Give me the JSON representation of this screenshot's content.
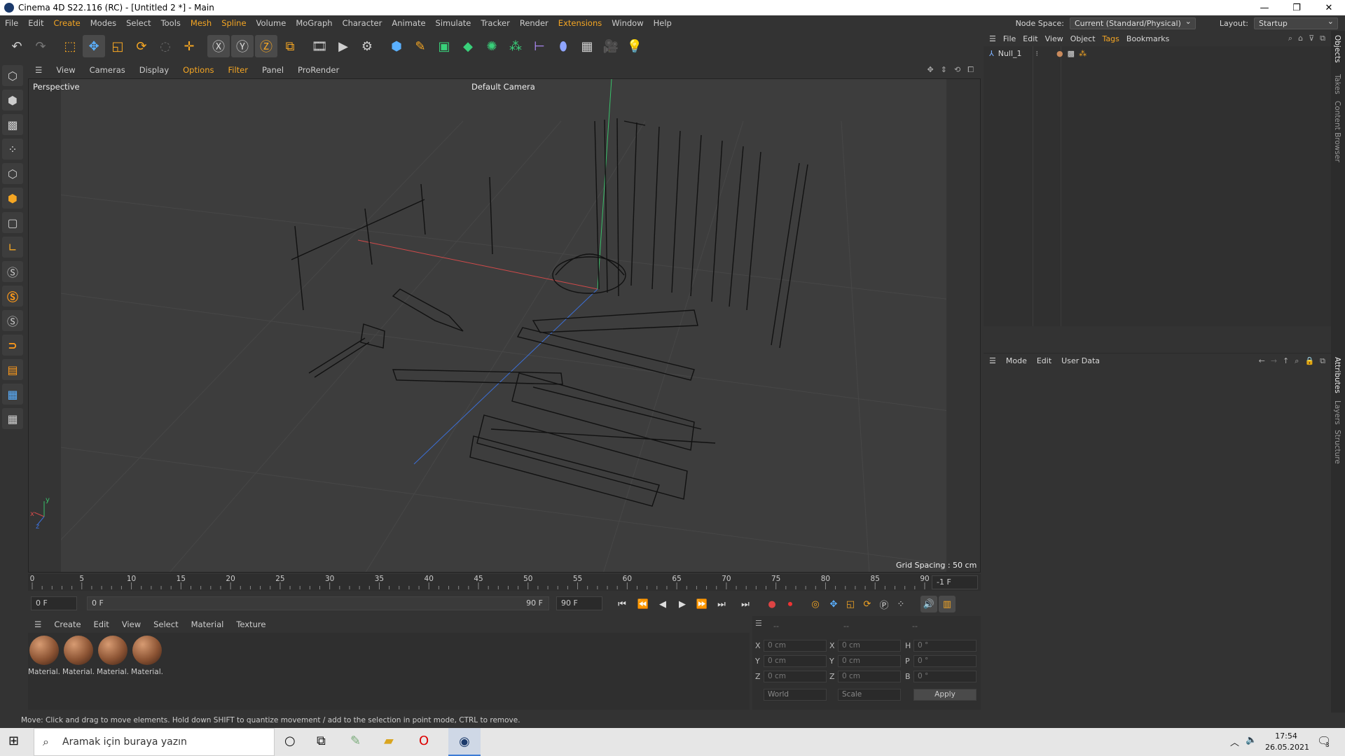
{
  "titlebar": {
    "title": "Cinema 4D S22.116 (RC) - [Untitled 2 *] - Main",
    "minimize": "—",
    "restore": "❐",
    "close": "✕"
  },
  "menubar": {
    "items": [
      "File",
      "Edit",
      "Create",
      "Modes",
      "Select",
      "Tools",
      "Mesh",
      "Spline",
      "Volume",
      "MoGraph",
      "Character",
      "Animate",
      "Simulate",
      "Tracker",
      "Render",
      "Extensions",
      "Window",
      "Help"
    ],
    "node_space_label": "Node Space:",
    "node_space_value": "Current (Standard/Physical)",
    "layout_label": "Layout:",
    "layout_value": "Startup"
  },
  "viewport_menu": {
    "items": [
      "View",
      "Cameras",
      "Display",
      "Options",
      "Filter",
      "Panel",
      "ProRender"
    ]
  },
  "viewport": {
    "view_name": "Perspective",
    "camera": "Default Camera",
    "grid_spacing": "Grid Spacing : 50 cm",
    "axis_y": "y",
    "axis_x": "x",
    "axis_z": "z"
  },
  "timeline": {
    "ticks": [
      "0",
      "5",
      "10",
      "15",
      "20",
      "25",
      "30",
      "35",
      "40",
      "45",
      "50",
      "55",
      "60",
      "65",
      "70",
      "75",
      "80",
      "85",
      "90"
    ],
    "current_frame_field": "-1 F"
  },
  "transport": {
    "start_field": "0 F",
    "range_start": "0 F",
    "range_end": "90 F",
    "end_field": "90 F"
  },
  "material_menu": {
    "items": [
      "Create",
      "Edit",
      "View",
      "Select",
      "Material",
      "Texture"
    ]
  },
  "materials": [
    "Material.",
    "Material.",
    "Material.",
    "Material."
  ],
  "coords": {
    "header": [
      "--",
      "--",
      "--"
    ],
    "rows": [
      {
        "a": "X",
        "av": "0 cm",
        "b": "X",
        "bv": "0 cm",
        "c": "H",
        "cv": "0 °"
      },
      {
        "a": "Y",
        "av": "0 cm",
        "b": "Y",
        "bv": "0 cm",
        "c": "P",
        "cv": "0 °"
      },
      {
        "a": "Z",
        "av": "0 cm",
        "b": "Z",
        "bv": "0 cm",
        "c": "B",
        "cv": "0 °"
      }
    ],
    "world": "World",
    "scale": "Scale",
    "apply": "Apply"
  },
  "status": "Move: Click and drag to move elements. Hold down SHIFT to quantize movement / add to the selection in point mode, CTRL to remove.",
  "object_manager": {
    "menu": [
      "File",
      "Edit",
      "View",
      "Object",
      "Tags",
      "Bookmarks"
    ],
    "object_name": "Null_1"
  },
  "attributes": {
    "menu": [
      "Mode",
      "Edit",
      "User Data"
    ]
  },
  "side_tabs": [
    "Objects",
    "Takes",
    "Content Browser",
    "Attributes",
    "Layers",
    "Structure"
  ],
  "taskbar": {
    "search_placeholder": "Aramak için buraya yazın",
    "time": "17:54",
    "date": "26.05.2021",
    "notif_count": "3"
  },
  "colors": {
    "accent": "#f5a623",
    "viewport_bg": "#3d3d3d"
  }
}
